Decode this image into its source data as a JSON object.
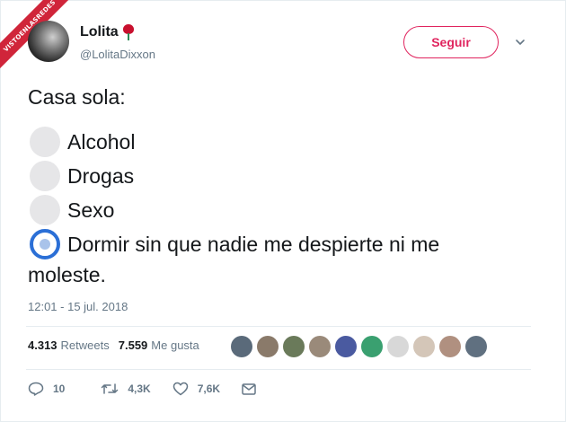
{
  "watermark": {
    "text": "VISTOENLASREDES"
  },
  "author": {
    "display_name": "Lolita",
    "emoji_icon": "rose-icon",
    "handle": "@LolitaDixxon"
  },
  "follow_button": {
    "label": "Seguir",
    "color": "#e0245e"
  },
  "tweet": {
    "intro": "Casa sola:",
    "poll_options": [
      {
        "label": "Alcohol",
        "selected": false
      },
      {
        "label": "Drogas",
        "selected": false
      },
      {
        "label": "Sexo",
        "selected": false
      },
      {
        "label": "Dormir sin que nadie me despierte ni me",
        "selected": true
      }
    ],
    "continuation": "moleste."
  },
  "timestamp": "12:01 - 15 jul. 2018",
  "stats": {
    "retweets_count": "4.313",
    "retweets_label": "Retweets",
    "likes_count": "7.559",
    "likes_label": "Me gusta"
  },
  "likers": [
    {
      "color": "#5a6a7a"
    },
    {
      "color": "#8a7a6a"
    },
    {
      "color": "#6a7a5a"
    },
    {
      "color": "#9a8a7a"
    },
    {
      "color": "#4a5aa0"
    },
    {
      "color": "#3aa070"
    },
    {
      "color": "#d8d8d8"
    },
    {
      "color": "#d4c6b8"
    },
    {
      "color": "#b09080"
    },
    {
      "color": "#607080"
    }
  ],
  "actions": {
    "replies": "10",
    "retweets": "4,3K",
    "likes": "7,6K"
  },
  "colors": {
    "accent_radio": "#2b6fd6",
    "muted": "#657786"
  }
}
